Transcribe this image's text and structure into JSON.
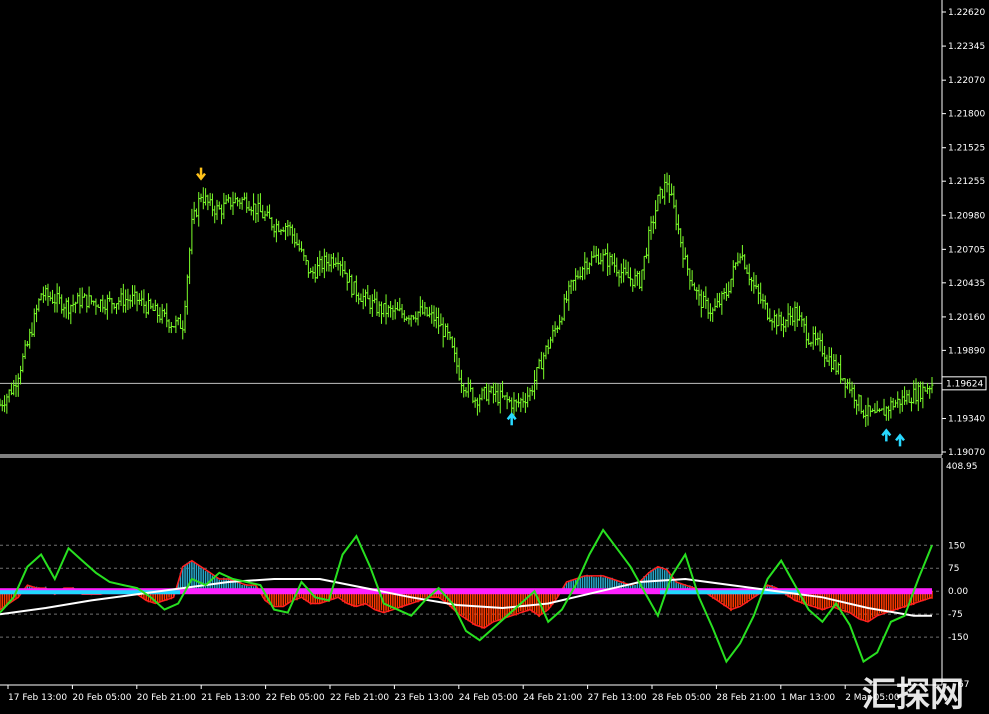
{
  "colors": {
    "background": "#000000",
    "candle": "#7cff2a",
    "grid_text": "#ffffff",
    "sell_arrow": "#ffc21a",
    "buy_arrow": "#28d8ff",
    "histogram_up": "#28a6c8",
    "histogram_down": "#ff3a00",
    "oscillator_line": "#28e020",
    "signal_line": "#ffffff",
    "red_line": "#ff2020",
    "zero_band_pink": "#ff20ff",
    "zero_band_cyan": "#20d8ff"
  },
  "icons": {
    "sell_arrow": "arrow-down-icon",
    "buy_arrow": "arrow-up-icon"
  },
  "current_price_label": "1.19624",
  "watermark_text": "汇探网",
  "indicator_top_label": "408.95",
  "indicator_bottom_label_partial": "67",
  "chart_data": [
    {
      "type": "line",
      "panel": "price",
      "ylim": [
        1.1907,
        1.2262
      ],
      "price_ticks": [
        "1.22620",
        "1.22345",
        "1.22070",
        "1.21800",
        "1.21525",
        "1.21255",
        "1.20980",
        "1.20705",
        "1.20435",
        "1.20160",
        "1.19890",
        "1.19624",
        "1.19340",
        "1.19070"
      ],
      "time_labels": [
        "17 Feb 13:00",
        "20 Feb 05:00",
        "20 Feb 21:00",
        "21 Feb 13:00",
        "22 Feb 05:00",
        "22 Feb 21:00",
        "23 Feb 13:00",
        "24 Feb 05:00",
        "24 Feb 21:00",
        "27 Feb 13:00",
        "28 Feb 05:00",
        "28 Feb 21:00",
        "1 Mar 13:00",
        "2 Mar 05:00"
      ],
      "close_points": [
        [
          0,
          1.1945
        ],
        [
          3,
          1.196
        ],
        [
          6,
          1.1993
        ],
        [
          9,
          1.2035
        ],
        [
          12,
          1.203
        ],
        [
          15,
          1.2025
        ],
        [
          18,
          1.203
        ],
        [
          21,
          1.2028
        ],
        [
          24,
          1.2028
        ],
        [
          27,
          1.203
        ],
        [
          30,
          1.203
        ],
        [
          33,
          1.2022
        ],
        [
          36,
          1.2015
        ],
        [
          38,
          1.201
        ],
        [
          40,
          1.201
        ],
        [
          42,
          1.209
        ],
        [
          44,
          1.2115
        ],
        [
          46,
          1.2105
        ],
        [
          48,
          1.2102
        ],
        [
          51,
          1.211
        ],
        [
          54,
          1.211
        ],
        [
          57,
          1.21
        ],
        [
          60,
          1.209
        ],
        [
          63,
          1.209
        ],
        [
          65,
          1.2075
        ],
        [
          68,
          1.205
        ],
        [
          71,
          1.206
        ],
        [
          74,
          1.2065
        ],
        [
          77,
          1.204
        ],
        [
          80,
          1.203
        ],
        [
          83,
          1.2022
        ],
        [
          86,
          1.202
        ],
        [
          89,
          1.2018
        ],
        [
          92,
          1.202
        ],
        [
          95,
          1.2015
        ],
        [
          98,
          1.2
        ],
        [
          101,
          1.1965
        ],
        [
          104,
          1.195
        ],
        [
          107,
          1.1955
        ],
        [
          110,
          1.195
        ],
        [
          113,
          1.1945
        ],
        [
          116,
          1.1955
        ],
        [
          119,
          1.1985
        ],
        [
          122,
          1.201
        ],
        [
          125,
          1.204
        ],
        [
          128,
          1.206
        ],
        [
          131,
          1.2065
        ],
        [
          134,
          1.206
        ],
        [
          137,
          1.2048
        ],
        [
          140,
          1.2045
        ],
        [
          142,
          1.208
        ],
        [
          144,
          1.211
        ],
        [
          146,
          1.2125
        ],
        [
          148,
          1.2095
        ],
        [
          150,
          1.206
        ],
        [
          153,
          1.203
        ],
        [
          156,
          1.202
        ],
        [
          159,
          1.2035
        ],
        [
          162,
          1.207
        ],
        [
          165,
          1.204
        ],
        [
          168,
          1.202
        ],
        [
          171,
          1.201
        ],
        [
          174,
          1.202
        ],
        [
          177,
          1.2
        ],
        [
          180,
          1.199
        ],
        [
          183,
          1.1975
        ],
        [
          186,
          1.196
        ],
        [
          189,
          1.194
        ],
        [
          192,
          1.1935
        ],
        [
          195,
          1.1945
        ],
        [
          198,
          1.195
        ],
        [
          201,
          1.1955
        ],
        [
          204,
          1.1962
        ]
      ],
      "sell_signals": [
        [
          44,
          1.213
        ]
      ],
      "buy_signals": [
        [
          112,
          1.1935
        ],
        [
          194,
          1.1922
        ],
        [
          197,
          1.1918
        ]
      ]
    },
    {
      "type": "line",
      "panel": "indicator",
      "ylim": [
        -290,
        408.95
      ],
      "level_labels": [
        "150",
        "75",
        "0.00",
        "-75",
        "-150"
      ],
      "levels": [
        150,
        75,
        0,
        -75,
        -150
      ],
      "green_line": [
        [
          0,
          -70
        ],
        [
          3,
          -20
        ],
        [
          6,
          80
        ],
        [
          9,
          120
        ],
        [
          12,
          40
        ],
        [
          15,
          140
        ],
        [
          18,
          100
        ],
        [
          21,
          60
        ],
        [
          24,
          30
        ],
        [
          27,
          20
        ],
        [
          30,
          10
        ],
        [
          33,
          -20
        ],
        [
          36,
          -60
        ],
        [
          39,
          -40
        ],
        [
          42,
          40
        ],
        [
          45,
          20
        ],
        [
          48,
          60
        ],
        [
          51,
          40
        ],
        [
          54,
          30
        ],
        [
          57,
          20
        ],
        [
          60,
          -60
        ],
        [
          63,
          -70
        ],
        [
          66,
          30
        ],
        [
          69,
          -20
        ],
        [
          72,
          -30
        ],
        [
          75,
          120
        ],
        [
          78,
          180
        ],
        [
          81,
          80
        ],
        [
          84,
          -40
        ],
        [
          87,
          -60
        ],
        [
          90,
          -80
        ],
        [
          93,
          -30
        ],
        [
          96,
          10
        ],
        [
          99,
          -40
        ],
        [
          102,
          -130
        ],
        [
          105,
          -160
        ],
        [
          108,
          -120
        ],
        [
          111,
          -80
        ],
        [
          114,
          -40
        ],
        [
          117,
          0
        ],
        [
          120,
          -100
        ],
        [
          123,
          -60
        ],
        [
          126,
          20
        ],
        [
          129,
          120
        ],
        [
          132,
          200
        ],
        [
          135,
          140
        ],
        [
          138,
          80
        ],
        [
          141,
          0
        ],
        [
          144,
          -80
        ],
        [
          147,
          50
        ],
        [
          150,
          120
        ],
        [
          153,
          -20
        ],
        [
          156,
          -120
        ],
        [
          159,
          -230
        ],
        [
          162,
          -170
        ],
        [
          165,
          -80
        ],
        [
          168,
          40
        ],
        [
          171,
          100
        ],
        [
          174,
          20
        ],
        [
          177,
          -60
        ],
        [
          180,
          -100
        ],
        [
          183,
          -40
        ],
        [
          186,
          -110
        ],
        [
          189,
          -230
        ],
        [
          192,
          -200
        ],
        [
          195,
          -100
        ],
        [
          198,
          -80
        ],
        [
          201,
          40
        ],
        [
          204,
          150
        ]
      ],
      "white_line": [
        [
          0,
          -75
        ],
        [
          10,
          -55
        ],
        [
          20,
          -30
        ],
        [
          30,
          -10
        ],
        [
          40,
          10
        ],
        [
          50,
          30
        ],
        [
          60,
          40
        ],
        [
          70,
          40
        ],
        [
          80,
          10
        ],
        [
          90,
          -20
        ],
        [
          100,
          -45
        ],
        [
          110,
          -55
        ],
        [
          120,
          -40
        ],
        [
          130,
          -5
        ],
        [
          140,
          30
        ],
        [
          150,
          40
        ],
        [
          160,
          20
        ],
        [
          170,
          0
        ],
        [
          180,
          -20
        ],
        [
          190,
          -55
        ],
        [
          200,
          -80
        ],
        [
          204,
          -80
        ]
      ],
      "histogram": [
        [
          0,
          -60
        ],
        [
          2,
          -40
        ],
        [
          4,
          -20
        ],
        [
          6,
          20
        ],
        [
          8,
          10
        ],
        [
          10,
          10
        ],
        [
          12,
          -10
        ],
        [
          14,
          10
        ],
        [
          16,
          10
        ],
        [
          18,
          -10
        ],
        [
          20,
          -10
        ],
        [
          22,
          -10
        ],
        [
          24,
          0
        ],
        [
          26,
          0
        ],
        [
          28,
          0
        ],
        [
          30,
          -10
        ],
        [
          32,
          -30
        ],
        [
          34,
          -40
        ],
        [
          36,
          -30
        ],
        [
          38,
          -20
        ],
        [
          40,
          80
        ],
        [
          42,
          100
        ],
        [
          44,
          80
        ],
        [
          46,
          60
        ],
        [
          48,
          40
        ],
        [
          50,
          40
        ],
        [
          52,
          30
        ],
        [
          54,
          20
        ],
        [
          56,
          20
        ],
        [
          58,
          -30
        ],
        [
          60,
          -50
        ],
        [
          62,
          -50
        ],
        [
          64,
          -30
        ],
        [
          66,
          -20
        ],
        [
          68,
          -40
        ],
        [
          70,
          -40
        ],
        [
          72,
          -30
        ],
        [
          74,
          -20
        ],
        [
          76,
          -40
        ],
        [
          78,
          -50
        ],
        [
          80,
          -40
        ],
        [
          82,
          -60
        ],
        [
          84,
          -70
        ],
        [
          86,
          -60
        ],
        [
          88,
          -50
        ],
        [
          90,
          -40
        ],
        [
          92,
          -30
        ],
        [
          94,
          -20
        ],
        [
          96,
          -20
        ],
        [
          98,
          -40
        ],
        [
          100,
          -70
        ],
        [
          102,
          -90
        ],
        [
          104,
          -110
        ],
        [
          106,
          -120
        ],
        [
          108,
          -100
        ],
        [
          110,
          -90
        ],
        [
          112,
          -80
        ],
        [
          114,
          -70
        ],
        [
          116,
          -60
        ],
        [
          118,
          -80
        ],
        [
          120,
          -60
        ],
        [
          122,
          -20
        ],
        [
          124,
          30
        ],
        [
          126,
          40
        ],
        [
          128,
          50
        ],
        [
          130,
          50
        ],
        [
          132,
          50
        ],
        [
          134,
          40
        ],
        [
          136,
          30
        ],
        [
          138,
          20
        ],
        [
          140,
          30
        ],
        [
          142,
          60
        ],
        [
          144,
          80
        ],
        [
          146,
          70
        ],
        [
          148,
          30
        ],
        [
          150,
          20
        ],
        [
          152,
          10
        ],
        [
          154,
          0
        ],
        [
          156,
          -20
        ],
        [
          158,
          -40
        ],
        [
          160,
          -60
        ],
        [
          162,
          -50
        ],
        [
          164,
          -30
        ],
        [
          166,
          -10
        ],
        [
          168,
          20
        ],
        [
          170,
          10
        ],
        [
          172,
          -10
        ],
        [
          174,
          -30
        ],
        [
          176,
          -40
        ],
        [
          178,
          -50
        ],
        [
          180,
          -60
        ],
        [
          182,
          -50
        ],
        [
          184,
          -60
        ],
        [
          186,
          -70
        ],
        [
          188,
          -90
        ],
        [
          190,
          -100
        ],
        [
          192,
          -80
        ],
        [
          194,
          -70
        ],
        [
          196,
          -60
        ],
        [
          198,
          -50
        ],
        [
          200,
          -40
        ],
        [
          202,
          -30
        ],
        [
          204,
          -20
        ]
      ]
    }
  ]
}
